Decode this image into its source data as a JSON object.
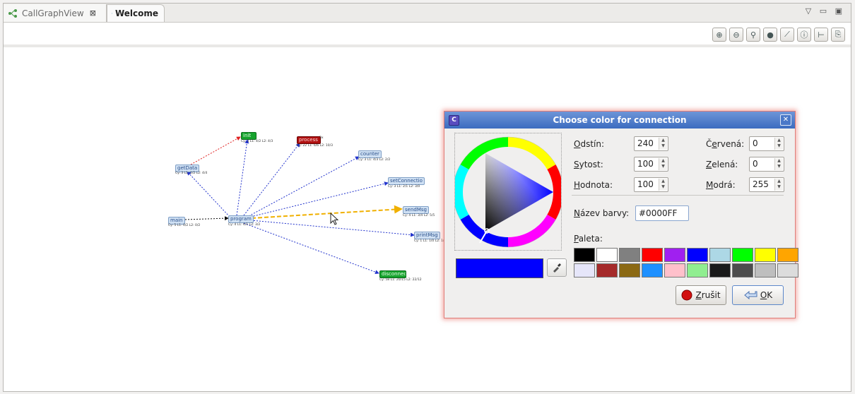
{
  "tabs": [
    {
      "label": "CallGraphView",
      "active": false,
      "closable": true,
      "close_symbol": "⊠"
    },
    {
      "label": "Welcome",
      "active": true
    }
  ],
  "window_controls": "▽ ▭ ▣",
  "toolbar": {
    "buttons": [
      {
        "name": "zoom-in",
        "glyph": "⊕"
      },
      {
        "name": "zoom-out",
        "glyph": "⊖"
      },
      {
        "name": "find-path",
        "glyph": "⚲"
      },
      {
        "name": "layout",
        "glyph": "●"
      },
      {
        "name": "connection",
        "glyph": "⟋"
      },
      {
        "name": "info",
        "glyph": "ⓘ"
      },
      {
        "name": "tree",
        "glyph": "⊢"
      },
      {
        "name": "export",
        "glyph": "⎘"
      }
    ]
  },
  "graph": {
    "nodes": [
      {
        "id": "main",
        "label": "main",
        "sub": "Cy: 5 L1: 0/2 L2: 0/2",
        "style": "blue"
      },
      {
        "id": "getData",
        "label": "getData",
        "sub": "Cy: 3 L1: 2/2 L2: 4/4",
        "style": "blue"
      },
      {
        "id": "green1",
        "label": "init",
        "sub": "Cy: 3 L1: 4/2 L2: 4/3",
        "style": "green"
      },
      {
        "id": "red1",
        "label": "process",
        "sub": "Cy: 22 L1: 6/6 L2: 10/3",
        "style": "red",
        "extra": "3x"
      },
      {
        "id": "counter",
        "label": "counter",
        "sub": "Cy: 3 L1: 4/3 L2: 2/2",
        "style": "blue"
      },
      {
        "id": "setConnection",
        "label": "setConnectio",
        "sub": "Cy: 3 L1: 2/1 L2: 3/0",
        "style": "blue"
      },
      {
        "id": "program",
        "label": "program",
        "sub": "Cy: 4 L1: 6/1 L2: 3/2",
        "style": "blue"
      },
      {
        "id": "sendMsg",
        "label": "sendMsg",
        "sub": "Cy: 4 L1: 3/4 L2: 5/5",
        "style": "blue"
      },
      {
        "id": "printMsg",
        "label": "printMsg",
        "sub": "Cy: 1 L1: 1/0 L2: 1/",
        "style": "blue"
      },
      {
        "id": "green2",
        "label": "disconnect",
        "sub": "Cy: 58 L1: 20/15 L2: 22/12",
        "style": "green"
      }
    ]
  },
  "dialog": {
    "title": "Choose color for connection",
    "hsv": {
      "hue_label": "Odstín:",
      "hue_value": "240",
      "sat_label": "Sytost:",
      "sat_value": "100",
      "val_label": "Hodnota:",
      "val_value": "100"
    },
    "rgb": {
      "red_label": "Červená:",
      "red_value": "0",
      "green_label": "Zelená:",
      "green_value": "0",
      "blue_label": "Modrá:",
      "blue_value": "255"
    },
    "color_name_label": "Název barvy:",
    "color_name_value": "#0000FF",
    "palette_label": "Paleta:",
    "current_color": "#0000ff",
    "palette": [
      "#000000",
      "#ffffff",
      "#808080",
      "#ff0000",
      "#a020f0",
      "#0000ff",
      "#add8e6",
      "#00ff00",
      "#ffff00",
      "#ffa500",
      "#e6e6fa",
      "#a52a2a",
      "#8b6914",
      "#1e90ff",
      "#ffc0cb",
      "#90ee90",
      "#1a1a1a",
      "#4d4d4d",
      "#bebebe",
      "#dcdcdc"
    ],
    "cancel_label": "Zrušit",
    "ok_label": "OK"
  }
}
